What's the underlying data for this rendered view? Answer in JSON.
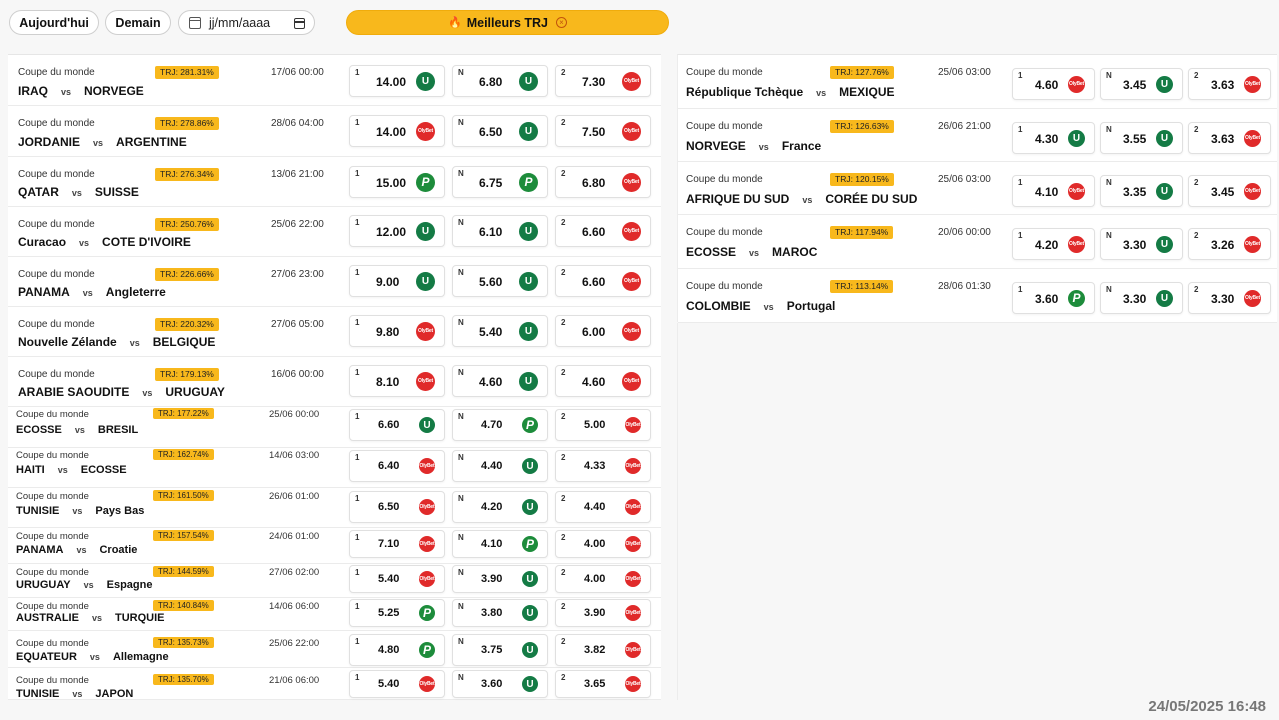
{
  "toolbar": {
    "today_label": "Aujourd'hui",
    "tomorrow_label": "Demain",
    "date_placeholder": "jj/mm/aaaa",
    "best_label": "Meilleurs TRJ"
  },
  "timestamp": "24/05/2025 16:48",
  "bookmakers": {
    "unibet": {
      "text": "U",
      "color": "#147b45"
    },
    "olybet": {
      "text": "OlyBet",
      "color": "#e02a2a"
    },
    "pmu": {
      "text": "P",
      "color": "#1d8c3b"
    }
  },
  "left_matches": [
    {
      "competition": "Coupe du monde",
      "trj": "TRJ: 281.31%",
      "date": "17/06 00:00",
      "home": "IRAQ",
      "away": "NORVEGE",
      "odds": [
        {
          "label": "1",
          "value": "14.00",
          "bookmaker": "unibet"
        },
        {
          "label": "N",
          "value": "6.80",
          "bookmaker": "unibet"
        },
        {
          "label": "2",
          "value": "7.30",
          "bookmaker": "olybet"
        }
      ]
    },
    {
      "competition": "Coupe du monde",
      "trj": "TRJ: 278.86%",
      "date": "28/06 04:00",
      "home": "JORDANIE",
      "away": "ARGENTINE",
      "odds": [
        {
          "label": "1",
          "value": "14.00",
          "bookmaker": "olybet"
        },
        {
          "label": "N",
          "value": "6.50",
          "bookmaker": "unibet"
        },
        {
          "label": "2",
          "value": "7.50",
          "bookmaker": "olybet"
        }
      ]
    },
    {
      "competition": "Coupe du monde",
      "trj": "TRJ: 276.34%",
      "date": "13/06 21:00",
      "home": "QATAR",
      "away": "SUISSE",
      "odds": [
        {
          "label": "1",
          "value": "15.00",
          "bookmaker": "pmu"
        },
        {
          "label": "N",
          "value": "6.75",
          "bookmaker": "pmu"
        },
        {
          "label": "2",
          "value": "6.80",
          "bookmaker": "olybet"
        }
      ]
    },
    {
      "competition": "Coupe du monde",
      "trj": "TRJ: 250.76%",
      "date": "25/06 22:00",
      "home": "Curacao",
      "away": "COTE D'IVOIRE",
      "odds": [
        {
          "label": "1",
          "value": "12.00",
          "bookmaker": "unibet"
        },
        {
          "label": "N",
          "value": "6.10",
          "bookmaker": "unibet"
        },
        {
          "label": "2",
          "value": "6.60",
          "bookmaker": "olybet"
        }
      ]
    },
    {
      "competition": "Coupe du monde",
      "trj": "TRJ: 226.66%",
      "date": "27/06 23:00",
      "home": "PANAMA",
      "away": "Angleterre",
      "odds": [
        {
          "label": "1",
          "value": "9.00",
          "bookmaker": "unibet"
        },
        {
          "label": "N",
          "value": "5.60",
          "bookmaker": "unibet"
        },
        {
          "label": "2",
          "value": "6.60",
          "bookmaker": "olybet"
        }
      ]
    },
    {
      "competition": "Coupe du monde",
      "trj": "TRJ: 220.32%",
      "date": "27/06 05:00",
      "home": "Nouvelle Zélande",
      "away": "BELGIQUE",
      "odds": [
        {
          "label": "1",
          "value": "9.80",
          "bookmaker": "olybet"
        },
        {
          "label": "N",
          "value": "5.40",
          "bookmaker": "unibet"
        },
        {
          "label": "2",
          "value": "6.00",
          "bookmaker": "olybet"
        }
      ]
    },
    {
      "competition": "Coupe du monde",
      "trj": "TRJ: 179.13%",
      "date": "16/06 00:00",
      "home": "ARABIE SAOUDITE",
      "away": "URUGUAY",
      "odds": [
        {
          "label": "1",
          "value": "8.10",
          "bookmaker": "olybet"
        },
        {
          "label": "N",
          "value": "4.60",
          "bookmaker": "unibet"
        },
        {
          "label": "2",
          "value": "4.60",
          "bookmaker": "olybet"
        }
      ]
    },
    {
      "competition": "Coupe du monde",
      "trj": "TRJ: 177.22%",
      "date": "25/06 00:00",
      "home": "ECOSSE",
      "away": "BRESIL",
      "odds": [
        {
          "label": "1",
          "value": "6.60",
          "bookmaker": "unibet"
        },
        {
          "label": "N",
          "value": "4.70",
          "bookmaker": "pmu"
        },
        {
          "label": "2",
          "value": "5.00",
          "bookmaker": "olybet"
        }
      ]
    },
    {
      "competition": "Coupe du monde",
      "trj": "TRJ: 162.74%",
      "date": "14/06 03:00",
      "home": "HAITI",
      "away": "ECOSSE",
      "odds": [
        {
          "label": "1",
          "value": "6.40",
          "bookmaker": "olybet"
        },
        {
          "label": "N",
          "value": "4.40",
          "bookmaker": "unibet"
        },
        {
          "label": "2",
          "value": "4.33",
          "bookmaker": "olybet"
        }
      ]
    },
    {
      "competition": "Coupe du monde",
      "trj": "TRJ: 161.50%",
      "date": "26/06 01:00",
      "home": "TUNISIE",
      "away": "Pays Bas",
      "odds": [
        {
          "label": "1",
          "value": "6.50",
          "bookmaker": "olybet"
        },
        {
          "label": "N",
          "value": "4.20",
          "bookmaker": "unibet"
        },
        {
          "label": "2",
          "value": "4.40",
          "bookmaker": "olybet"
        }
      ]
    },
    {
      "competition": "Coupe du monde",
      "trj": "TRJ: 157.54%",
      "date": "24/06 01:00",
      "home": "PANAMA",
      "away": "Croatie",
      "odds": [
        {
          "label": "1",
          "value": "7.10",
          "bookmaker": "olybet"
        },
        {
          "label": "N",
          "value": "4.10",
          "bookmaker": "pmu"
        },
        {
          "label": "2",
          "value": "4.00",
          "bookmaker": "olybet"
        }
      ]
    },
    {
      "competition": "Coupe du monde",
      "trj": "TRJ: 144.59%",
      "date": "27/06 02:00",
      "home": "URUGUAY",
      "away": "Espagne",
      "odds": [
        {
          "label": "1",
          "value": "5.40",
          "bookmaker": "olybet"
        },
        {
          "label": "N",
          "value": "3.90",
          "bookmaker": "unibet"
        },
        {
          "label": "2",
          "value": "4.00",
          "bookmaker": "olybet"
        }
      ]
    },
    {
      "competition": "Coupe du monde",
      "trj": "TRJ: 140.84%",
      "date": "14/06 06:00",
      "home": "AUSTRALIE",
      "away": "TURQUIE",
      "odds": [
        {
          "label": "1",
          "value": "5.25",
          "bookmaker": "pmu"
        },
        {
          "label": "N",
          "value": "3.80",
          "bookmaker": "unibet"
        },
        {
          "label": "2",
          "value": "3.90",
          "bookmaker": "olybet"
        }
      ]
    },
    {
      "competition": "Coupe du monde",
      "trj": "TRJ: 135.73%",
      "date": "25/06 22:00",
      "home": "EQUATEUR",
      "away": "Allemagne",
      "odds": [
        {
          "label": "1",
          "value": "4.80",
          "bookmaker": "pmu"
        },
        {
          "label": "N",
          "value": "3.75",
          "bookmaker": "unibet"
        },
        {
          "label": "2",
          "value": "3.82",
          "bookmaker": "olybet"
        }
      ]
    },
    {
      "competition": "Coupe du monde",
      "trj": "TRJ: 135.70%",
      "date": "21/06 06:00",
      "home": "TUNISIE",
      "away": "JAPON",
      "odds": [
        {
          "label": "1",
          "value": "5.40",
          "bookmaker": "olybet"
        },
        {
          "label": "N",
          "value": "3.60",
          "bookmaker": "unibet"
        },
        {
          "label": "2",
          "value": "3.65",
          "bookmaker": "olybet"
        }
      ]
    }
  ],
  "right_matches": [
    {
      "competition": "Coupe du monde",
      "trj": "TRJ: 127.76%",
      "date": "25/06 03:00",
      "home": "République Tchèque",
      "away": "MEXIQUE",
      "odds": [
        {
          "label": "1",
          "value": "4.60",
          "bookmaker": "olybet"
        },
        {
          "label": "N",
          "value": "3.45",
          "bookmaker": "unibet"
        },
        {
          "label": "2",
          "value": "3.63",
          "bookmaker": "olybet"
        }
      ]
    },
    {
      "competition": "Coupe du monde",
      "trj": "TRJ: 126.63%",
      "date": "26/06 21:00",
      "home": "NORVEGE",
      "away": "France",
      "odds": [
        {
          "label": "1",
          "value": "4.30",
          "bookmaker": "unibet"
        },
        {
          "label": "N",
          "value": "3.55",
          "bookmaker": "unibet"
        },
        {
          "label": "2",
          "value": "3.63",
          "bookmaker": "olybet"
        }
      ]
    },
    {
      "competition": "Coupe du monde",
      "trj": "TRJ: 120.15%",
      "date": "25/06 03:00",
      "home": "AFRIQUE DU SUD",
      "away": "CORÉE DU SUD",
      "odds": [
        {
          "label": "1",
          "value": "4.10",
          "bookmaker": "olybet"
        },
        {
          "label": "N",
          "value": "3.35",
          "bookmaker": "unibet"
        },
        {
          "label": "2",
          "value": "3.45",
          "bookmaker": "olybet"
        }
      ]
    },
    {
      "competition": "Coupe du monde",
      "trj": "TRJ: 117.94%",
      "date": "20/06 00:00",
      "home": "ECOSSE",
      "away": "MAROC",
      "odds": [
        {
          "label": "1",
          "value": "4.20",
          "bookmaker": "olybet"
        },
        {
          "label": "N",
          "value": "3.30",
          "bookmaker": "unibet"
        },
        {
          "label": "2",
          "value": "3.26",
          "bookmaker": "olybet"
        }
      ]
    },
    {
      "competition": "Coupe du monde",
      "trj": "TRJ: 113.14%",
      "date": "28/06 01:30",
      "home": "COLOMBIE",
      "away": "Portugal",
      "odds": [
        {
          "label": "1",
          "value": "3.60",
          "bookmaker": "pmu"
        },
        {
          "label": "N",
          "value": "3.30",
          "bookmaker": "unibet"
        },
        {
          "label": "2",
          "value": "3.30",
          "bookmaker": "olybet"
        }
      ]
    }
  ]
}
